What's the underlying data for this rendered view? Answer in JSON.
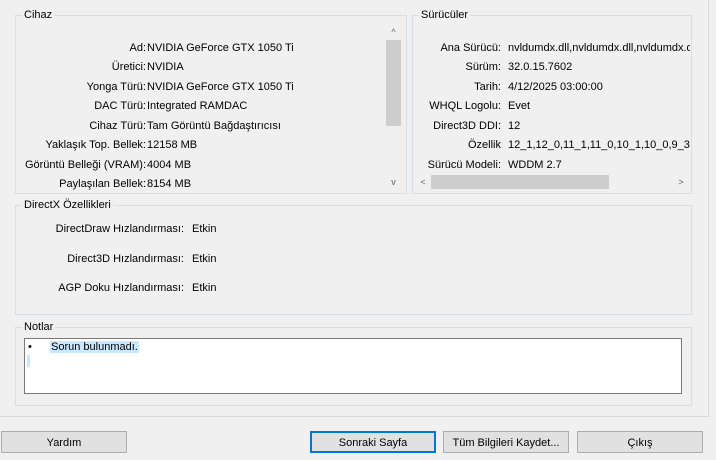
{
  "device": {
    "title": "Cihaz",
    "rows": [
      {
        "label": "Ad:",
        "value": "NVIDIA GeForce GTX 1050 Ti"
      },
      {
        "label": "Üretici:",
        "value": "NVIDIA"
      },
      {
        "label": "Yonga Türü:",
        "value": "NVIDIA GeForce GTX 1050 Ti"
      },
      {
        "label": "DAC Türü:",
        "value": "Integrated RAMDAC"
      },
      {
        "label": "Cihaz Türü:",
        "value": "Tam Görüntü Bağdaştırıcısı"
      },
      {
        "label": "Yaklaşık Top. Bellek:",
        "value": "12158 MB"
      },
      {
        "label": "Görüntü Belleği (VRAM):",
        "value": "4004 MB"
      },
      {
        "label": "Paylaşılan Bellek:",
        "value": "8154 MB"
      }
    ]
  },
  "drivers": {
    "title": "Sürücüler",
    "rows": [
      {
        "label": "Ana Sürücü:",
        "value": "nvldumdx.dll,nvldumdx.dll,nvldumdx.dll"
      },
      {
        "label": "Sürüm:",
        "value": "32.0.15.7602"
      },
      {
        "label": "Tarih:",
        "value": "4/12/2025 03:00:00"
      },
      {
        "label": "WHQL Logolu:",
        "value": "Evet"
      },
      {
        "label": "Direct3D DDI:",
        "value": "12"
      },
      {
        "label": "Özellik",
        "value": "12_1,12_0,11_1,11_0,10_1,10_0,9_3"
      },
      {
        "label": "Sürücü Modeli:",
        "value": "WDDM 2.7"
      }
    ]
  },
  "directx": {
    "title": "DirectX Özellikleri",
    "rows": [
      {
        "label": "DirectDraw Hızlandırması:",
        "value": "Etkin"
      },
      {
        "label": "Direct3D Hızlandırması:",
        "value": "Etkin"
      },
      {
        "label": "AGP Doku Hızlandırması:",
        "value": "Etkin"
      }
    ]
  },
  "notes": {
    "title": "Notlar",
    "bullet": "•",
    "text": "Sorun bulunmadı."
  },
  "buttons": {
    "help": "Yardım",
    "next_page": "Sonraki Sayfa",
    "save_all": "Tüm Bilgileri Kaydet...",
    "exit": "Çıkış"
  },
  "icons": {
    "scroll_up": "^",
    "scroll_down": "v",
    "scroll_left": "<",
    "scroll_right": ">"
  }
}
